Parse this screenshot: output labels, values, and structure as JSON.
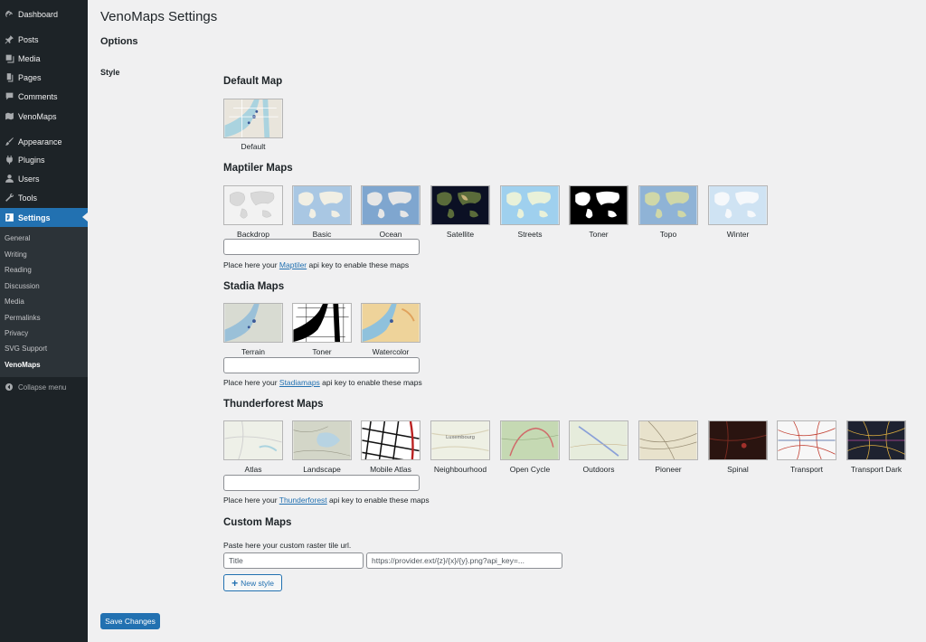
{
  "sidebar": {
    "items": [
      {
        "label": "Dashboard",
        "icon": "dashboard-icon"
      },
      {
        "label": "Posts",
        "icon": "pin-icon"
      },
      {
        "label": "Media",
        "icon": "media-icon"
      },
      {
        "label": "Pages",
        "icon": "pages-icon"
      },
      {
        "label": "Comments",
        "icon": "comment-icon"
      },
      {
        "label": "VenoMaps",
        "icon": "map-icon"
      },
      {
        "label": "Appearance",
        "icon": "brush-icon"
      },
      {
        "label": "Plugins",
        "icon": "plugin-icon"
      },
      {
        "label": "Users",
        "icon": "user-icon"
      },
      {
        "label": "Tools",
        "icon": "wrench-icon"
      },
      {
        "label": "Settings",
        "icon": "settings-icon"
      }
    ],
    "submenu": [
      "General",
      "Writing",
      "Reading",
      "Discussion",
      "Media",
      "Permalinks",
      "Privacy",
      "SVG Support",
      "VenoMaps"
    ],
    "collapse_label": "Collapse menu"
  },
  "page": {
    "title": "VenoMaps Settings",
    "options_title": "Options",
    "style_label": "Style"
  },
  "sections": {
    "default": {
      "title": "Default Map",
      "tiles": [
        "Default"
      ]
    },
    "maptiler": {
      "title": "Maptiler Maps",
      "tiles": [
        "Backdrop",
        "Basic",
        "Ocean",
        "Satellite",
        "Streets",
        "Toner",
        "Topo",
        "Winter"
      ],
      "help_prefix": "Place here your ",
      "help_link": "Maptiler",
      "help_suffix": " api key to enable these maps"
    },
    "stadia": {
      "title": "Stadia Maps",
      "tiles": [
        "Terrain",
        "Toner",
        "Watercolor"
      ],
      "help_prefix": "Place here your ",
      "help_link": "Stadiamaps",
      "help_suffix": " api key to enable these maps"
    },
    "thunderforest": {
      "title": "Thunderforest Maps",
      "tiles": [
        "Atlas",
        "Landscape",
        "Mobile Atlas",
        "Neighbourhood",
        "Open Cycle",
        "Outdoors",
        "Pioneer",
        "Spinal",
        "Transport",
        "Transport Dark"
      ],
      "help_prefix": "Place here your ",
      "help_link": "Thunderforest",
      "help_suffix": " api key to enable these maps"
    },
    "custom": {
      "title": "Custom Maps",
      "help": "Paste here your custom raster tile url.",
      "title_placeholder": "Title",
      "url_placeholder": "https://provider.ext/{z}/{x}/{y}.png?api_key=...",
      "new_style_label": "New style"
    }
  },
  "save_label": "Save Changes",
  "colors": {
    "admin_bar": "#1d2327",
    "submenu_bg": "#2c3338",
    "accent": "#2271b1",
    "page_bg": "#f0f0f1"
  }
}
